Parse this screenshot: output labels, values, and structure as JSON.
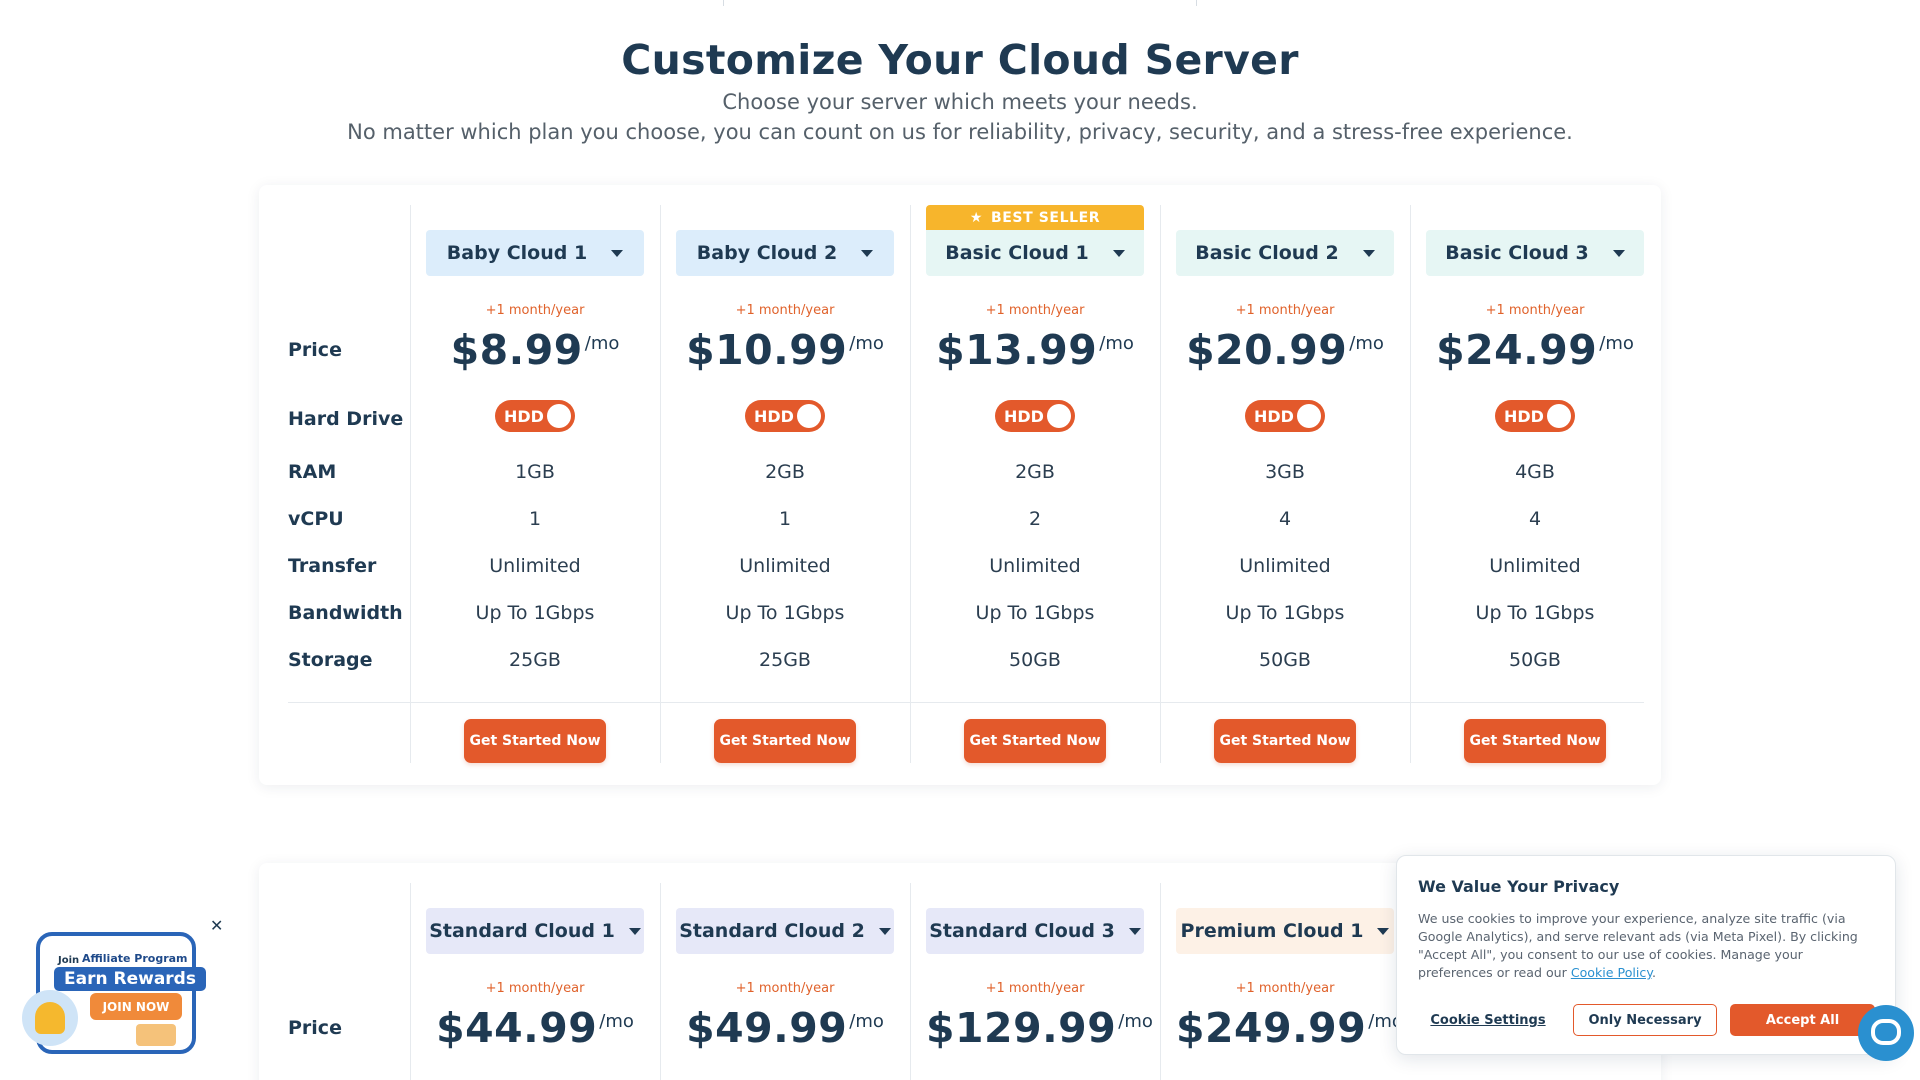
{
  "hero": {
    "title": "Customize Your Cloud Server",
    "subtitle": "Choose your server which meets your needs.",
    "tagline": "No matter which plan you choose, you can count on us for reliability, privacy, security, and a stress-free experience."
  },
  "row_labels": {
    "price": "Price",
    "hard_drive": "Hard Drive",
    "ram": "RAM",
    "vcpu": "vCPU",
    "transfer": "Transfer",
    "bandwidth": "Bandwidth",
    "storage": "Storage"
  },
  "term_note": "+1 month/year",
  "price_unit": "/mo",
  "toggle_label": "HDD",
  "cta_label": "Get Started Now",
  "best_seller_label": "BEST SELLER",
  "plans": [
    {
      "name": "Baby Cloud 1",
      "price": "$8.99",
      "ram": "1GB",
      "vcpu": "1",
      "transfer": "Unlimited",
      "bandwidth": "Up To 1Gbps",
      "storage": "25GB"
    },
    {
      "name": "Baby Cloud 2",
      "price": "$10.99",
      "ram": "2GB",
      "vcpu": "1",
      "transfer": "Unlimited",
      "bandwidth": "Up To 1Gbps",
      "storage": "25GB"
    },
    {
      "name": "Basic Cloud 1",
      "price": "$13.99",
      "ram": "2GB",
      "vcpu": "2",
      "transfer": "Unlimited",
      "bandwidth": "Up To 1Gbps",
      "storage": "50GB"
    },
    {
      "name": "Basic Cloud 2",
      "price": "$20.99",
      "ram": "3GB",
      "vcpu": "4",
      "transfer": "Unlimited",
      "bandwidth": "Up To 1Gbps",
      "storage": "50GB"
    },
    {
      "name": "Basic Cloud 3",
      "price": "$24.99",
      "ram": "4GB",
      "vcpu": "4",
      "transfer": "Unlimited",
      "bandwidth": "Up To 1Gbps",
      "storage": "50GB"
    }
  ],
  "plans2": [
    {
      "name": "Standard Cloud 1",
      "price": "$44.99"
    },
    {
      "name": "Standard Cloud 2",
      "price": "$49.99"
    },
    {
      "name": "Standard Cloud 3",
      "price": "$129.99"
    },
    {
      "name": "Premium Cloud 1",
      "price": "$249.99"
    }
  ],
  "affiliate": {
    "join": "Join",
    "program": "Affiliate Program",
    "earn": "Earn Rewards",
    "join_now": "JOIN NOW",
    "close": "✕"
  },
  "privacy": {
    "title": "We Value Your Privacy",
    "body": "We use cookies to improve your experience, analyze site traffic (via Google Analytics), and serve relevant ads (via Meta Pixel). By clicking \"Accept All\", you consent to our use of cookies. Manage your preferences or read our ",
    "link": "Cookie Policy",
    "period": ".",
    "settings": "Cookie Settings",
    "necessary": "Only Necessary",
    "accept": "Accept All"
  },
  "colors": {
    "accent": "#e3592b",
    "heading": "#1f3a52",
    "badge": "#f7b52c",
    "link": "#2a90d0"
  }
}
